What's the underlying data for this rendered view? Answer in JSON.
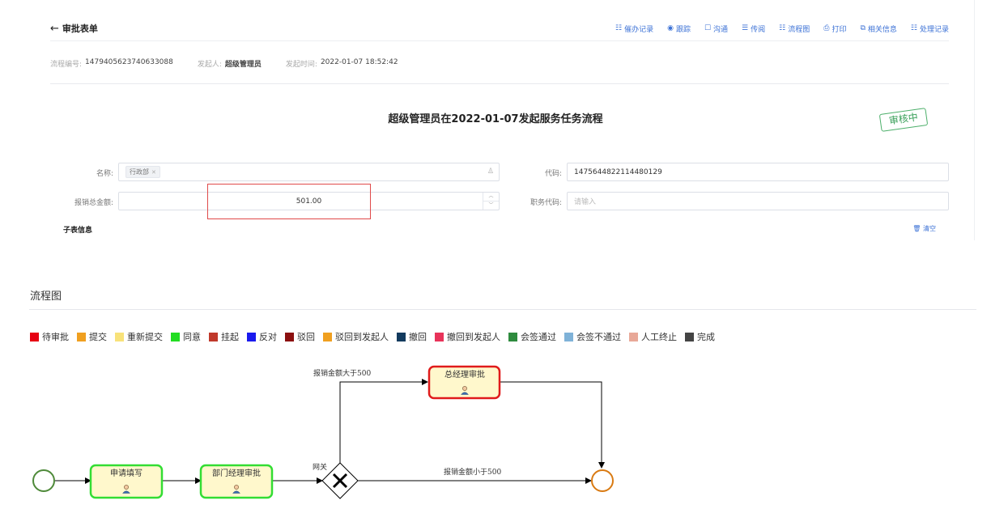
{
  "header": {
    "back_label": "审批表单",
    "actions": [
      {
        "icon": "reminder-icon",
        "glyph": "☷",
        "label": "催办记录"
      },
      {
        "icon": "track-icon",
        "glyph": "◉",
        "label": "跟踪"
      },
      {
        "icon": "chat-icon",
        "glyph": "☐",
        "label": "沟通"
      },
      {
        "icon": "forward-icon",
        "glyph": "☰",
        "label": "传阅"
      },
      {
        "icon": "flowchart-icon",
        "glyph": "☷",
        "label": "流程图"
      },
      {
        "icon": "print-icon",
        "glyph": "⎙",
        "label": "打印"
      },
      {
        "icon": "related-icon",
        "glyph": "⧉",
        "label": "相关信息"
      },
      {
        "icon": "history-icon",
        "glyph": "☷",
        "label": "处理记录"
      }
    ]
  },
  "meta": {
    "flow_no_label": "流程编号:",
    "flow_no": "1479405623740633088",
    "initiator_label": "发起人:",
    "initiator": "超级管理员",
    "time_label": "发起时间:",
    "time": "2022-01-07 18:52:42"
  },
  "form": {
    "title": "超级管理员在2022-01-07发起服务任务流程",
    "stamp": "审核中",
    "name_label": "名称:",
    "name_tag": "行政部",
    "code_label": "代码:",
    "code_value": "1475644822114480129",
    "amount_label": "报销总金额:",
    "amount_value": "501.00",
    "job_code_label": "职务代码:",
    "job_code_placeholder": "请输入",
    "sub_title": "子表信息",
    "clear_label": "清空"
  },
  "flow": {
    "heading": "流程图",
    "legend": [
      {
        "label": "待审批",
        "color": "#e60012"
      },
      {
        "label": "提交",
        "color": "#f0a020"
      },
      {
        "label": "重新提交",
        "color": "#f8e27a"
      },
      {
        "label": "同意",
        "color": "#22dd22"
      },
      {
        "label": "挂起",
        "color": "#c0392b"
      },
      {
        "label": "反对",
        "color": "#1a1aee"
      },
      {
        "label": "驳回",
        "color": "#8b1010"
      },
      {
        "label": "驳回到发起人",
        "color": "#f0a020"
      },
      {
        "label": "撤回",
        "color": "#123a5e"
      },
      {
        "label": "撤回到发起人",
        "color": "#e8335a"
      },
      {
        "label": "会签通过",
        "color": "#2e8b3e"
      },
      {
        "label": "会签不通过",
        "color": "#7fb2d8"
      },
      {
        "label": "人工终止",
        "color": "#e8a898"
      },
      {
        "label": "完成",
        "color": "#444444"
      }
    ],
    "nodes": {
      "apply": "申请填写",
      "dept": "部门经理审批",
      "gm": "总经理审批",
      "gateway": "网关"
    },
    "edges": {
      "gt500": "报销金额大于500",
      "lt500": "报销金额小于500"
    }
  }
}
